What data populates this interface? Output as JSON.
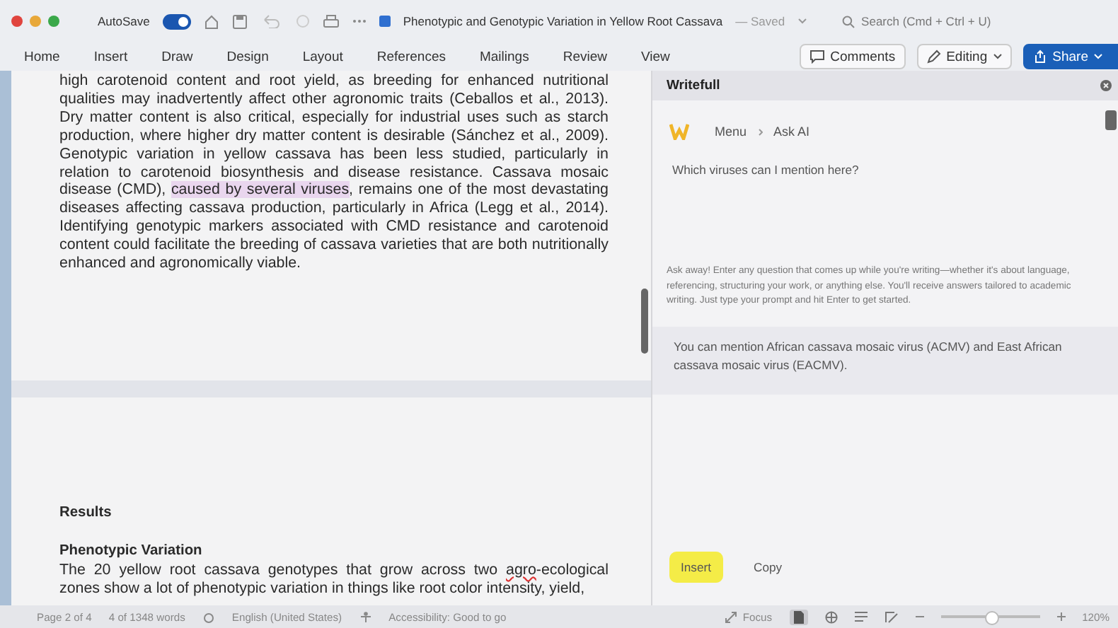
{
  "window": {
    "autosave_label": "AutoSave",
    "autosave_on": true,
    "title": "Phenotypic and Genotypic Variation in Yellow Root Cassava",
    "saved_status": "— Saved",
    "search_placeholder": "Search (Cmd + Ctrl + U)"
  },
  "ribbon": {
    "tabs": [
      "Home",
      "Insert",
      "Draw",
      "Design",
      "Layout",
      "References",
      "Mailings",
      "Review",
      "View"
    ],
    "comments_button": "Comments",
    "editing_button": "Editing",
    "share_button": "Share"
  },
  "document": {
    "intro_segments": [
      {
        "kind": "plain",
        "text": "high carotenoid content and root yield, as breeding for enhanced nutritional qualities may inadvertently affect other agronomic traits (Ceballos et al., 2013). Dry matter content is also critical, especially for industrial uses such as starch production, where higher dry matter content is desirable (Sánchez et al., 2009). Genotypic variation in yellow cassava has been less studied, particularly in relation to carotenoid biosynthesis and disease resistance. Cassava mosaic disease (CMD), "
      },
      {
        "kind": "highlight",
        "text": "caused by several viruses"
      },
      {
        "kind": "plain",
        "text": ", remains one of the most devastating diseases affecting cassava production, particularly in Africa (Legg et al., 2014). Identifying genotypic markers associated with CMD resistance and carotenoid content could facilitate the breeding of cassava varieties that are both nutritionally enhanced and agronomically viable."
      }
    ],
    "section_heading": "Results",
    "subheading": "Phenotypic Variation",
    "results_segments": [
      {
        "kind": "plain",
        "text": "The 20 yellow root cassava genotypes that grow across two "
      },
      {
        "kind": "misspelled",
        "text": "agro"
      },
      {
        "kind": "plain",
        "text": "-ecological zones show a lot of phenotypic variation in things like root color intensity, yield,"
      }
    ]
  },
  "panel": {
    "title": "Writefull",
    "breadcrumb": [
      "Menu",
      "Ask AI"
    ],
    "question": "Which viruses can I mention here?",
    "hint": "Ask away! Enter any question that comes up while you're writing—whether it's about language, referencing, structuring your work, or anything else. You'll receive answers tailored to academic writing. Just type your prompt and hit Enter to get started.",
    "answer": "You can mention African cassava mosaic virus (ACMV) and East African cassava mosaic virus (EACMV).",
    "buttons": [
      {
        "label": "Insert",
        "kind": "primary"
      },
      {
        "label": "Copy",
        "kind": "plain"
      }
    ]
  },
  "status_bar": {
    "page": "Page 2 of 4",
    "words": "4 of 1348 words",
    "language": "English (United States)",
    "accessibility": "Accessibility: Good to go",
    "focus": "Focus",
    "zoom": {
      "level": 0.5
    },
    "zoom_label": "120%"
  }
}
